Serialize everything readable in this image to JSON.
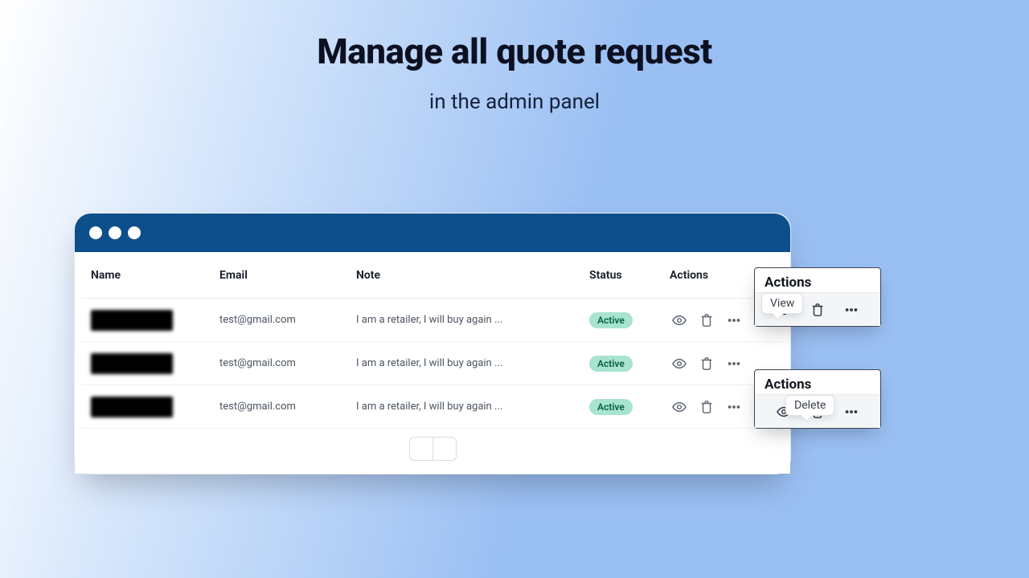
{
  "headline": {
    "title": "Manage all quote request",
    "subtitle": "in the admin panel"
  },
  "table": {
    "columns": {
      "name": "Name",
      "email": "Email",
      "note": "Note",
      "status": "Status",
      "actions": "Actions"
    },
    "rows": [
      {
        "email": "test@gmail.com",
        "note": "I am a retailer, I will buy again ...",
        "status": "Active"
      },
      {
        "email": "test@gmail.com",
        "note": "I am a retailer, I will buy again ...",
        "status": "Active"
      },
      {
        "email": "test@gmail.com",
        "note": "I am a retailer, I will buy again ...",
        "status": "Active"
      }
    ]
  },
  "callouts": {
    "view": {
      "title": "Actions",
      "tooltip": "View"
    },
    "delete": {
      "title": "Actions",
      "tooltip": "Delete"
    }
  },
  "icons": {
    "eye": "eye-icon",
    "trash": "trash-icon",
    "more": "more-icon",
    "prev": "chevron-left-icon",
    "next": "chevron-right-icon"
  }
}
